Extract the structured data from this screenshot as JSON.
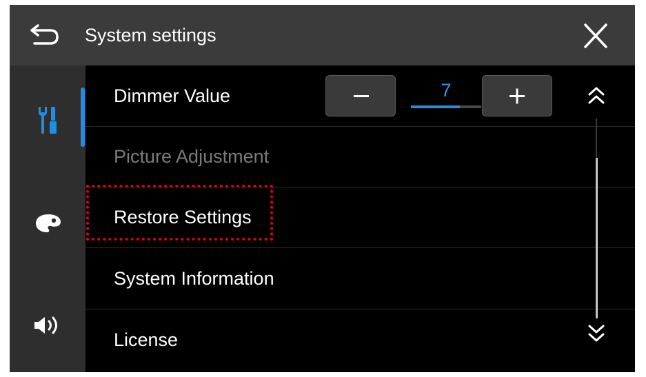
{
  "header": {
    "title": "System settings",
    "back_icon": "back-arrow-icon",
    "close_icon": "close-icon"
  },
  "sidebar": {
    "items": [
      {
        "icon": "tools-icon",
        "selected": true
      },
      {
        "icon": "palette-icon",
        "selected": false
      },
      {
        "icon": "speaker-icon",
        "selected": false
      }
    ]
  },
  "rows": [
    {
      "label": "Dimmer Value",
      "enabled": true
    },
    {
      "label": "Picture Adjustment",
      "enabled": false
    },
    {
      "label": "Restore Settings",
      "enabled": true
    },
    {
      "label": "System Information",
      "enabled": true
    },
    {
      "label": "License",
      "enabled": true
    }
  ],
  "dimmer": {
    "value": "7",
    "level_fraction": 0.7,
    "minus_icon": "minus-icon",
    "plus_icon": "plus-icon"
  },
  "scroll": {
    "up_icon": "double-chevron-up-icon",
    "down_icon": "double-chevron-down-icon"
  },
  "colors": {
    "accent": "#1e8fe6",
    "value_text": "#2a97ea",
    "highlight": "#e0001a",
    "header_bg": "#3b3b3b",
    "sidebar_bg": "#2e2e2e"
  }
}
